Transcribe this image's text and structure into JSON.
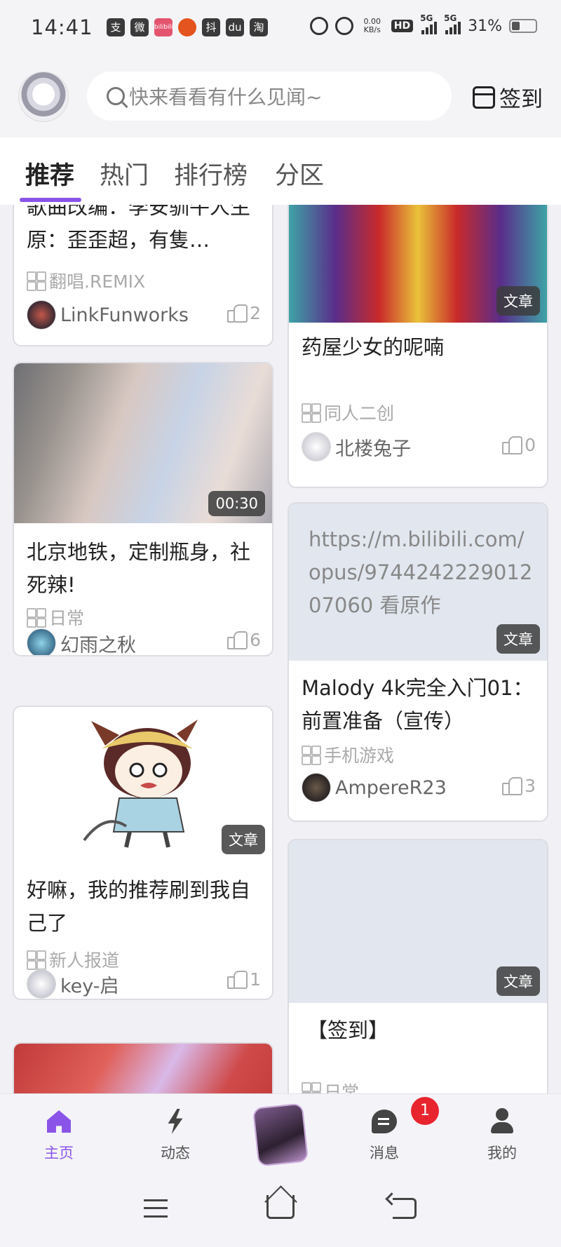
{
  "status_bar": {
    "time": "14:41",
    "app_icons": [
      "支",
      "微",
      "bilibili",
      "橙",
      "抖",
      "du",
      "淘"
    ],
    "net_speed": "0.00 KB/s",
    "hd": "HD",
    "sim1": "5G",
    "sim2": "5G",
    "battery": "31%"
  },
  "header": {
    "search_placeholder": "快来看看有什么见闻~",
    "signin_label": "签到"
  },
  "tabs": [
    "推荐",
    "热门",
    "排行榜",
    "分区"
  ],
  "feed": {
    "left": [
      {
        "title": "歌曲改编：李安驯牛人生 原：歪歪超，有隻…",
        "category": "翻唱.REMIX",
        "author": "LinkFunworks",
        "likes": "2"
      },
      {
        "title": "北京地铁，定制瓶身，社死辣!",
        "category": "日常",
        "author": "幻雨之秋",
        "likes": "6",
        "duration": "00:30"
      },
      {
        "title": "好嘛，我的推荐刷到我自己了",
        "category": "新人报道",
        "author": "key-启",
        "likes": "1",
        "badge": "文章"
      }
    ],
    "right": [
      {
        "title": "药屋少女的呢喃",
        "category": "同人二创",
        "author": "北楼兔子",
        "likes": "0",
        "badge": "文章"
      },
      {
        "preview_text": "https://m.bilibili.com/opus/974424222901207060 看原作",
        "title": "Malody 4k完全入门01：前置准备（宣传）",
        "category": "手机游戏",
        "author": "AmpereR23",
        "likes": "3",
        "badge": "文章"
      },
      {
        "title": "【签到】",
        "category": "日常",
        "badge": "文章"
      }
    ]
  },
  "bottom_nav": [
    {
      "label": "主页",
      "icon": "home-icon"
    },
    {
      "label": "动态",
      "icon": "bolt-icon"
    },
    {
      "label": "",
      "icon": "center-publish-icon"
    },
    {
      "label": "消息",
      "icon": "message-icon",
      "badge": "1"
    },
    {
      "label": "我的",
      "icon": "user-icon"
    }
  ],
  "colors": {
    "accent": "#8a54e8",
    "badge_red": "#e8242e"
  }
}
